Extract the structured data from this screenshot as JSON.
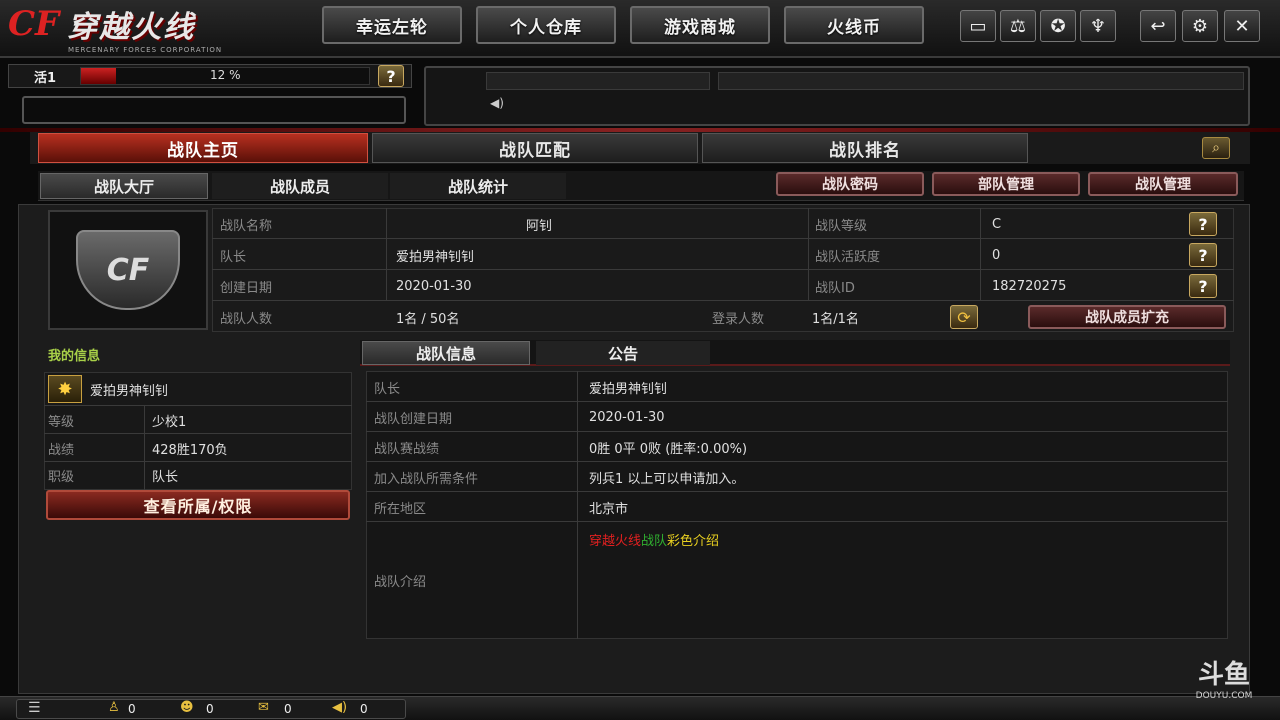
{
  "logo": {
    "text": "穿越火线",
    "sub": "MERCENARY FORCES CORPORATION"
  },
  "top_buttons": [
    "幸运左轮",
    "个人仓库",
    "游戏商城",
    "火线币"
  ],
  "status": {
    "label": "活1",
    "percent": "12 %",
    "help": "?"
  },
  "main_tabs": [
    "战队主页",
    "战队匹配",
    "战队排名"
  ],
  "sub_tabs": [
    "战队大厅",
    "战队成员",
    "战队统计"
  ],
  "action_buttons": [
    "战队密码",
    "部队管理",
    "战队管理"
  ],
  "info": {
    "name_label": "战队名称",
    "name": "阿钊",
    "leader_label": "队长",
    "leader": "爱拍男神钊钊",
    "created_label": "创建日期",
    "created": "2020-01-30",
    "count_label": "战队人数",
    "count": "1名 / 50名",
    "online_label": "登录人数",
    "online": "1名/1名",
    "level_label": "战队等级",
    "level": "C",
    "activity_label": "战队活跃度",
    "activity": "0",
    "id_label": "战队ID",
    "id": "182720275",
    "expand_button": "战队成员扩充"
  },
  "my_info": {
    "title": "我的信息",
    "name": "爱拍男神钊钊",
    "rank_label": "等级",
    "rank": "少校1",
    "record_label": "战绩",
    "record": "428胜170负",
    "role_label": "职级",
    "role": "队长",
    "view_button": "查看所属/权限"
  },
  "detail_tabs": [
    "战队信息",
    "公告"
  ],
  "details": [
    {
      "label": "队长",
      "value": "爱拍男神钊钊"
    },
    {
      "label": "战队创建日期",
      "value": "2020-01-30"
    },
    {
      "label": "战队赛战绩",
      "value": "0胜 0平 0败 (胜率:0.00%)"
    },
    {
      "label": "加入战队所需条件",
      "value": "列兵1 以上可以申请加入。"
    },
    {
      "label": "所在地区",
      "value": "北京市"
    }
  ],
  "intro": {
    "label": "战队介绍",
    "part1": "穿越火线",
    "part2": "战队",
    "part3": "彩色介绍"
  },
  "bottom": {
    "c1": "0",
    "c2": "0",
    "c3": "0",
    "c4": "0"
  },
  "watermark": {
    "text": "斗鱼",
    "sub": "DOUYU.COM"
  }
}
